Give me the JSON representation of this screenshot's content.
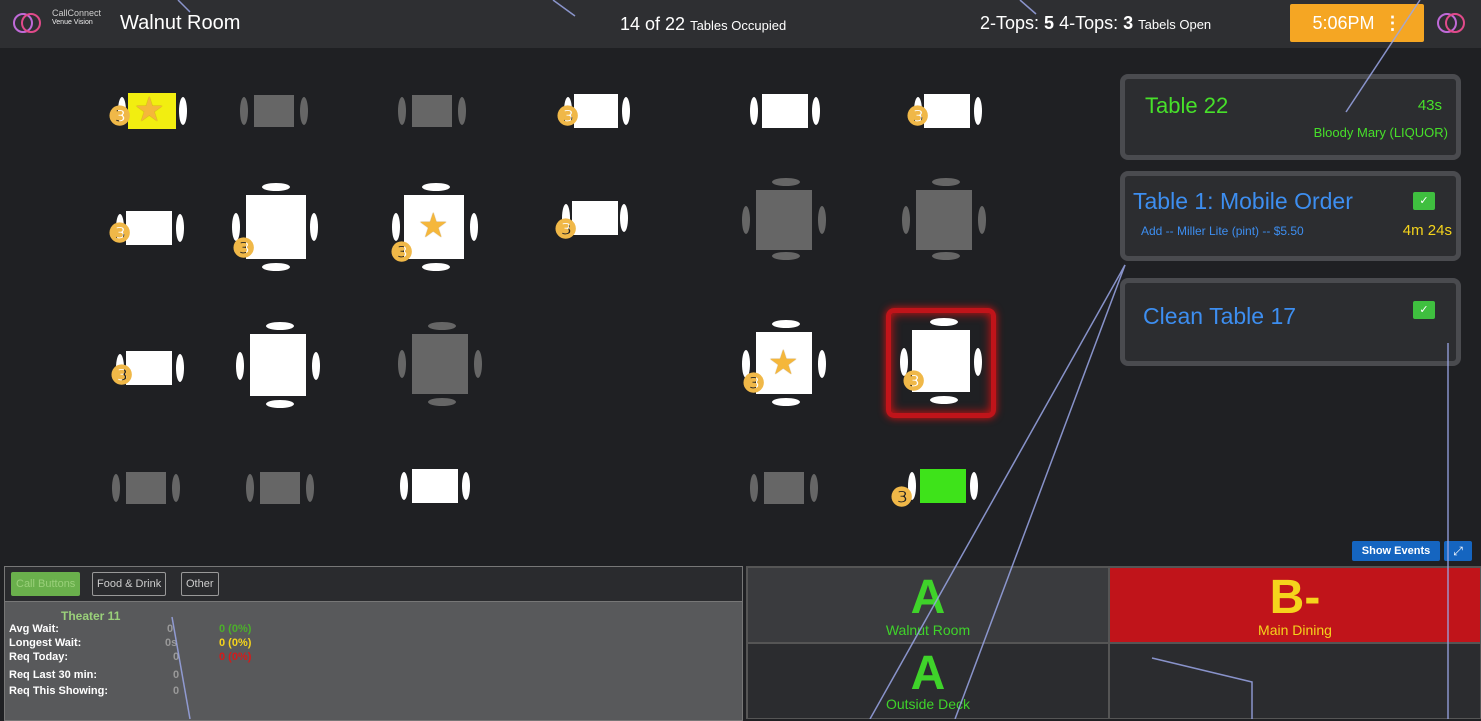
{
  "header": {
    "brand": "CallConnect",
    "brand_sub": "Venue Vision",
    "room_title": "Walnut Room",
    "occupied_count": "14 of 22",
    "occupied_label": "Tables Occupied",
    "twotops_label": "2-Tops:",
    "twotops_value": "5",
    "fourtops_label": "4-Tops:",
    "fourtops_value": "3",
    "open_label": "Tabels Open",
    "clock": "5:06PM",
    "clock_menu_icon": "vertical-dots-icon",
    "accent_color": "#f5a623"
  },
  "events": [
    {
      "title": "Table 22",
      "timer": "43s",
      "detail": "Bloody Mary (LIQUOR)",
      "color": "#47e02a"
    },
    {
      "title": "Table 1: Mobile Order",
      "detail": "Add -- Miller Lite (pint) -- $5.50",
      "timer": "4m 24s",
      "color": "#3d8ef0"
    },
    {
      "title": "Clean Table 17",
      "color": "#3d8ef0"
    }
  ],
  "buttons": {
    "show_events": "Show Events",
    "expand": "⤢"
  },
  "stats": {
    "tabs": [
      "Call Buttons",
      "Food & Drink",
      "Other"
    ],
    "venue": "Theater 11",
    "rows": [
      {
        "label": "Avg Wait:",
        "value": "0",
        "extra": "0 (0%)",
        "extra_color": "#4caf2a"
      },
      {
        "label": "Longest Wait:",
        "value": "0s",
        "extra": "0 (0%)",
        "extra_color": "#f5d41c"
      },
      {
        "label": "Req Today:",
        "value": "0",
        "extra": "0 (0%)",
        "extra_color": "#d41b1b"
      },
      {
        "label": "Req Last 30 min:",
        "value": "0",
        "extra": "",
        "extra_color": ""
      },
      {
        "label": "Req This Showing:",
        "value": "0",
        "extra": "",
        "extra_color": ""
      }
    ]
  },
  "grades": [
    {
      "letter": "A",
      "name": "Walnut Room",
      "letter_color": "#3fd32a",
      "name_color": "#3fd32a",
      "bg": "#3a3b3e"
    },
    {
      "letter": "B-",
      "name": "Main Dining",
      "letter_color": "#f5d41c",
      "name_color": "#f5d41c",
      "bg": "#c0141a"
    },
    {
      "letter": "A",
      "name": "Outside Deck",
      "letter_color": "#3fd32a",
      "name_color": "#3fd32a",
      "bg": "#2b2c2f"
    },
    {
      "letter": "",
      "name": "",
      "letter_color": "",
      "name_color": "",
      "bg": "#2b2c2f"
    }
  ]
}
